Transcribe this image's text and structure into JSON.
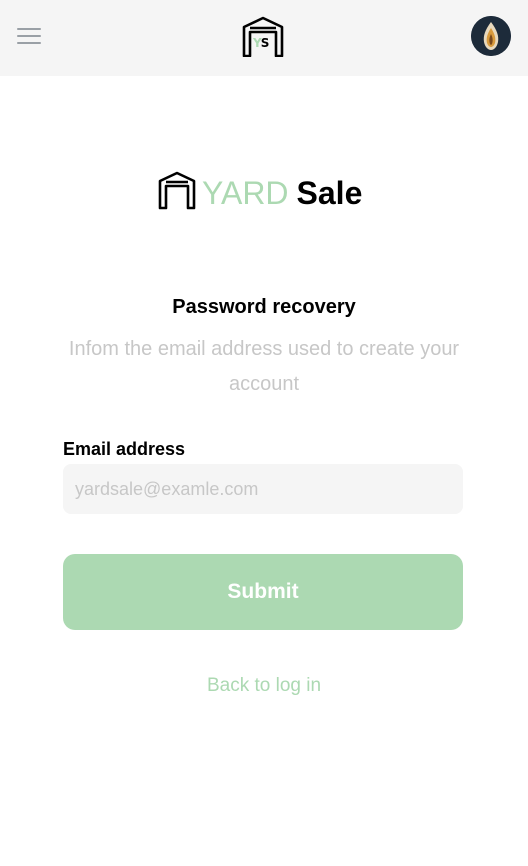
{
  "header": {
    "menu_icon": "hamburger-menu-icon",
    "logo_letters": {
      "y": "Y",
      "s": "S"
    },
    "avatar_icon": "user-avatar"
  },
  "brand": {
    "word1": "YARD",
    "word2": "Sale"
  },
  "form": {
    "title": "Password recovery",
    "subtitle": "Infom the email address used to create your account",
    "email_label": "Email address",
    "email_placeholder": "yardsale@examle.com",
    "email_value": "",
    "submit_label": "Submit"
  },
  "footer": {
    "back_link": "Back to log in"
  },
  "colors": {
    "accent": "#acd9b2",
    "muted": "#c7c7c7",
    "field_bg": "#f5f5f5",
    "header_bg": "#f5f5f5"
  }
}
